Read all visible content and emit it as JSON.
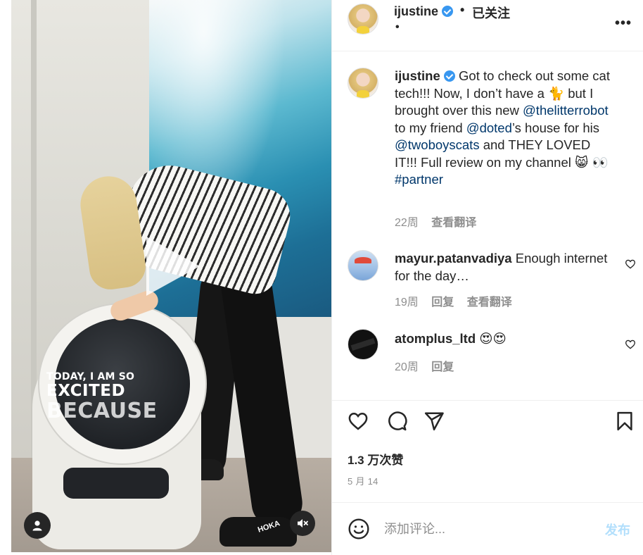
{
  "post": {
    "username": "ijustine",
    "follow_status": "已关注",
    "more_label": "•••",
    "separator": "•"
  },
  "video": {
    "overlay_line1": "TODAY, I AM SO",
    "overlay_line2": "EXCITED",
    "overlay_line3": "BECAUSE",
    "shoe_brand": "HOKA",
    "icons": {
      "play": "play-icon",
      "user": "user-icon",
      "mute": "muted-speaker-icon"
    }
  },
  "caption": {
    "username": "ijustine",
    "text_1": "Got to check out some cat tech!!! Now, I don’t have a ",
    "emoji_cat": "🐈",
    "text_2": " but I brought over this new ",
    "mention_1": "@thelitterrobot",
    "text_3": " to my friend ",
    "mention_2": "@doted",
    "text_4": "’s house for his ",
    "mention_3": "@twoboyscats",
    "text_5": " and THEY LOVED IT!!! Full review on my channel ",
    "emoji_cat_face": "😸",
    "text_6": " ",
    "emoji_eyes": "👀",
    "text_7": " ",
    "hashtag": "#partner",
    "time": "22周",
    "translate": "查看翻译"
  },
  "comments": [
    {
      "username": "mayur.patanvadiya",
      "text": " Enough internet for the day…",
      "time": "19周",
      "reply": "回复",
      "translate": "查看翻译"
    },
    {
      "username": "atomplus_ltd",
      "text": " 😍😍",
      "time": "20周",
      "reply": "回复"
    }
  ],
  "actions": {
    "likes": "1.3 万次赞",
    "date": "5 月 14"
  },
  "compose": {
    "placeholder": "添加评论...",
    "post_label": "发布"
  },
  "colors": {
    "verified": "#3897f0",
    "mention": "#00376b",
    "muted_text": "#8e8e8e",
    "post_button_disabled": "#b2dffc"
  }
}
